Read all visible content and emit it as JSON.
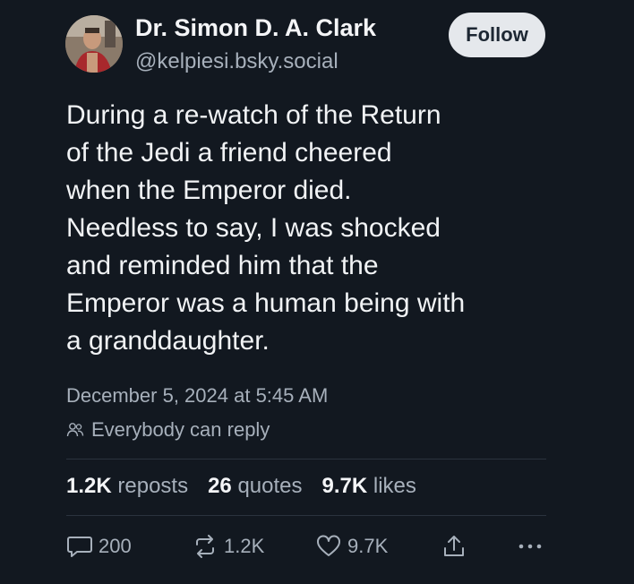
{
  "author": {
    "name": "Dr. Simon D. A. Clark",
    "handle": "@kelpiesi.bsky.social",
    "avatar_icon": "profile-photo"
  },
  "follow_label": "Follow",
  "post": {
    "lines": [
      "During a re-watch of the Return",
      "of the Jedi a friend cheered",
      "when the Emperor died.",
      "Needless to say, I was shocked",
      "and reminded him that the",
      "Emperor was a human being with",
      "a granddaughter."
    ],
    "timestamp": "December 5, 2024 at 5:45 AM",
    "reply_setting": "Everybody can reply"
  },
  "stats": {
    "reposts_count": "1.2K",
    "reposts_label": "reposts",
    "quotes_count": "26",
    "quotes_label": "quotes",
    "likes_count": "9.7K",
    "likes_label": "likes"
  },
  "actions": {
    "reply_count": "200",
    "repost_count": "1.2K",
    "like_count": "9.7K"
  },
  "colors": {
    "background": "#121820",
    "text": "#f1f3f5",
    "muted": "#a7b0bb",
    "button_bg": "#e5e8ec"
  }
}
